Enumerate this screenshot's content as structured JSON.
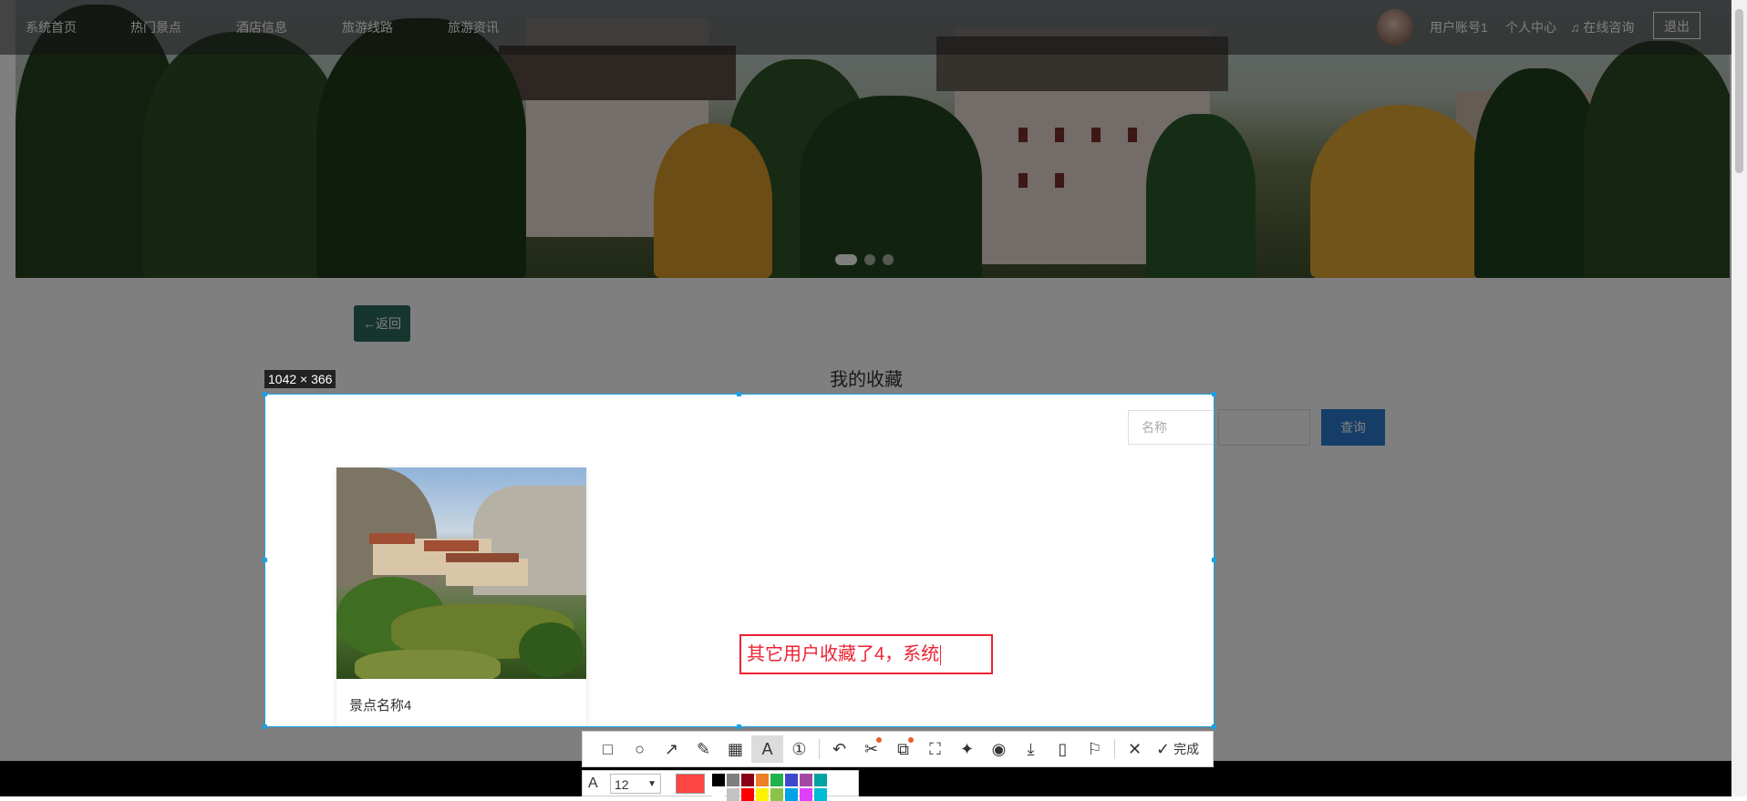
{
  "nav": {
    "items": [
      "系统首页",
      "热门景点",
      "酒店信息",
      "旅游线路",
      "旅游资讯"
    ],
    "user": "用户账号1",
    "profile": "个人中心",
    "consult": "在线咨询",
    "logout": "退出"
  },
  "page": {
    "back_label": "←返回",
    "title": "我的收藏"
  },
  "selection": {
    "size": "1042 × 366"
  },
  "search": {
    "placeholder": "名称",
    "button": "查询"
  },
  "card": {
    "name": "景点名称4"
  },
  "annotation": {
    "text": "其它用户收藏了4，系统"
  },
  "toolbar": {
    "done_label": "完成",
    "tools": [
      "rectangle-icon",
      "ellipse-icon",
      "arrow-icon",
      "pencil-icon",
      "mosaic-icon",
      "text-icon",
      "number-icon",
      "undo-icon",
      "cut-icon",
      "translate-icon",
      "ocr-icon",
      "pin-icon",
      "record-icon",
      "download-icon",
      "phone-icon",
      "bookmark-icon",
      "close-icon"
    ]
  },
  "text_options": {
    "font_size": "12",
    "current_color": "#ff4444",
    "palette": [
      "#000000",
      "#7f7f7f",
      "#880015",
      "#ed7f27",
      "#22b14c",
      "#3f48cc",
      "#a349a4",
      "#00a2a2",
      "#ffffff",
      "#c3c3c3",
      "#ff0000",
      "#fff200",
      "#8bc34a",
      "#00a2e8",
      "#e040fb",
      "#00bcd4"
    ]
  }
}
